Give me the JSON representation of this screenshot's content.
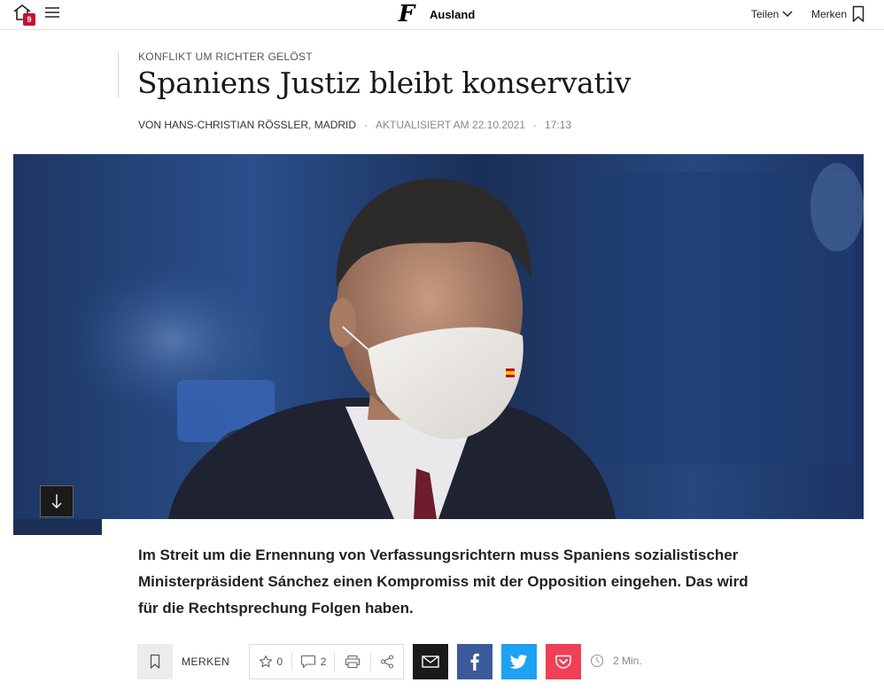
{
  "topbar": {
    "notification_count": "9",
    "section": "Ausland",
    "share_label": "Teilen",
    "bookmark_label": "Merken",
    "logo": "F"
  },
  "article": {
    "kicker": "KONFLIKT UM RICHTER GELÖST",
    "headline": "Spaniens Justiz bleibt konservativ",
    "author": "VON HANS-CHRISTIAN RÖSSLER, MADRID",
    "updated": "AKTUALISIERT AM 22.10.2021",
    "time": "17:13",
    "lead": "Im Streit um die Ernennung von Verfassungsrichtern muss Spaniens sozialistischer Ministerpräsident Sánchez einen Kompromiss mit der Opposition eingehen. Das wird für die Rechtsprechung Folgen haben."
  },
  "actions": {
    "bookmark_label": "MERKEN",
    "favorites_count": "0",
    "comments_count": "2",
    "read_time": "2 Min."
  },
  "colors": {
    "facebook": "#3b5a9a",
    "twitter": "#1da1f2",
    "pocket": "#ef4056",
    "mail": "#1a1a1a",
    "badge": "#c8102e"
  },
  "icons": [
    "home-icon",
    "menu-icon",
    "chevron-down-icon",
    "bookmark-icon",
    "arrow-down-icon",
    "star-icon",
    "comment-icon",
    "print-icon",
    "share-icon",
    "mail-icon",
    "facebook-icon",
    "twitter-icon",
    "pocket-icon",
    "clock-icon"
  ]
}
